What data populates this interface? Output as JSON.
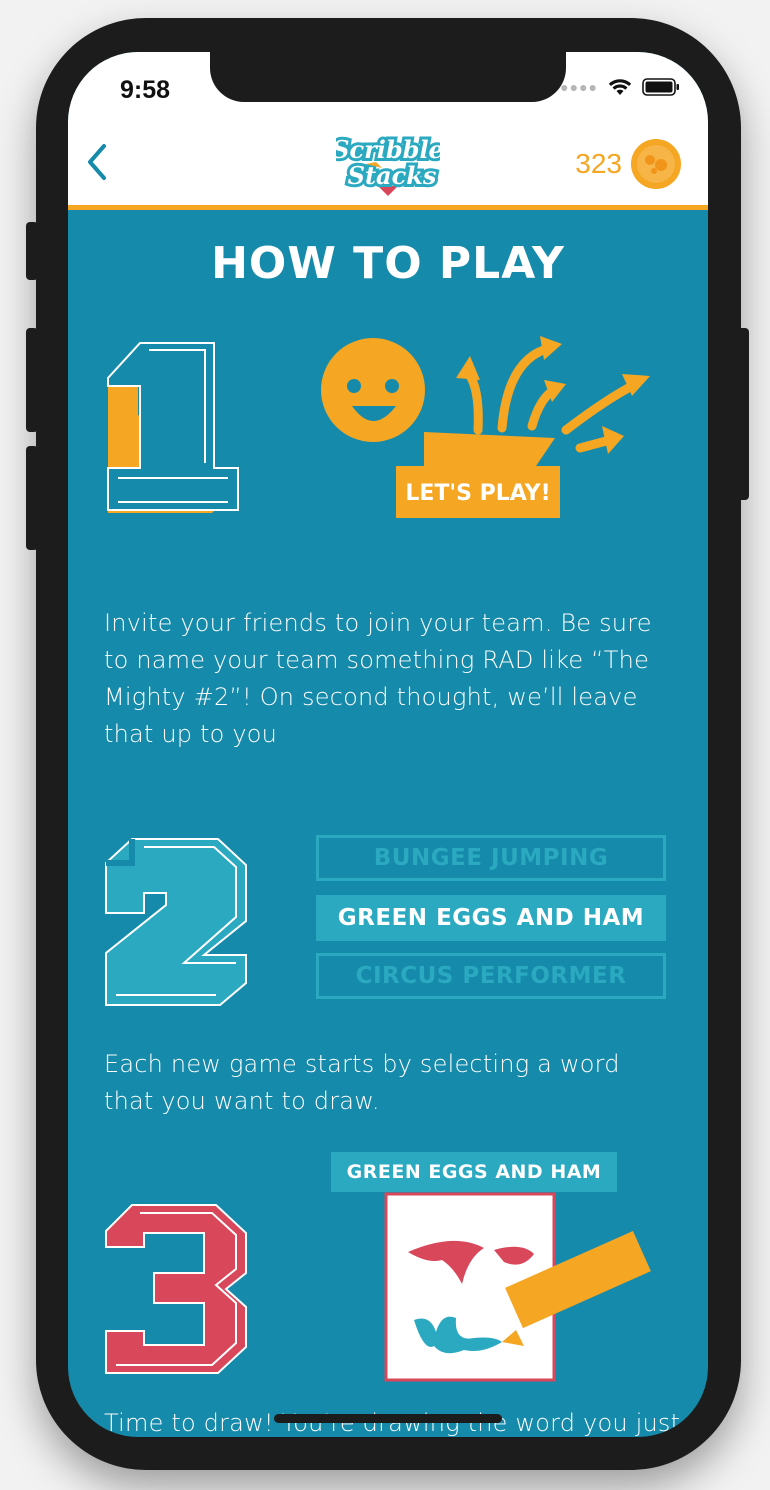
{
  "status": {
    "time": "9:58"
  },
  "header": {
    "coins": "323",
    "logo_text_top": "Scribble",
    "logo_text_bottom": "Stacks"
  },
  "page": {
    "title": "HOW TO PLAY"
  },
  "steps": [
    {
      "number": "1",
      "illustration_label": "LET'S PLAY!",
      "text": "Invite your friends to join your team. Be sure to name your team something RAD like “The Mighty #2”! On second thought, we’ll leave that up to you"
    },
    {
      "number": "2",
      "word_options": [
        "BUNGEE JUMPING",
        "GREEN EGGS AND HAM",
        "CIRCUS PERFORMER"
      ],
      "text": "Each new game starts by selecting a word that you want to draw."
    },
    {
      "number": "3",
      "word_banner": "GREEN EGGS AND HAM",
      "text": "Time to draw! You're drawing the word you just"
    }
  ],
  "colors": {
    "background": "#168aaa",
    "accent": "#f5a623",
    "teal": "#2aa9c0",
    "red": "#d9475b"
  }
}
